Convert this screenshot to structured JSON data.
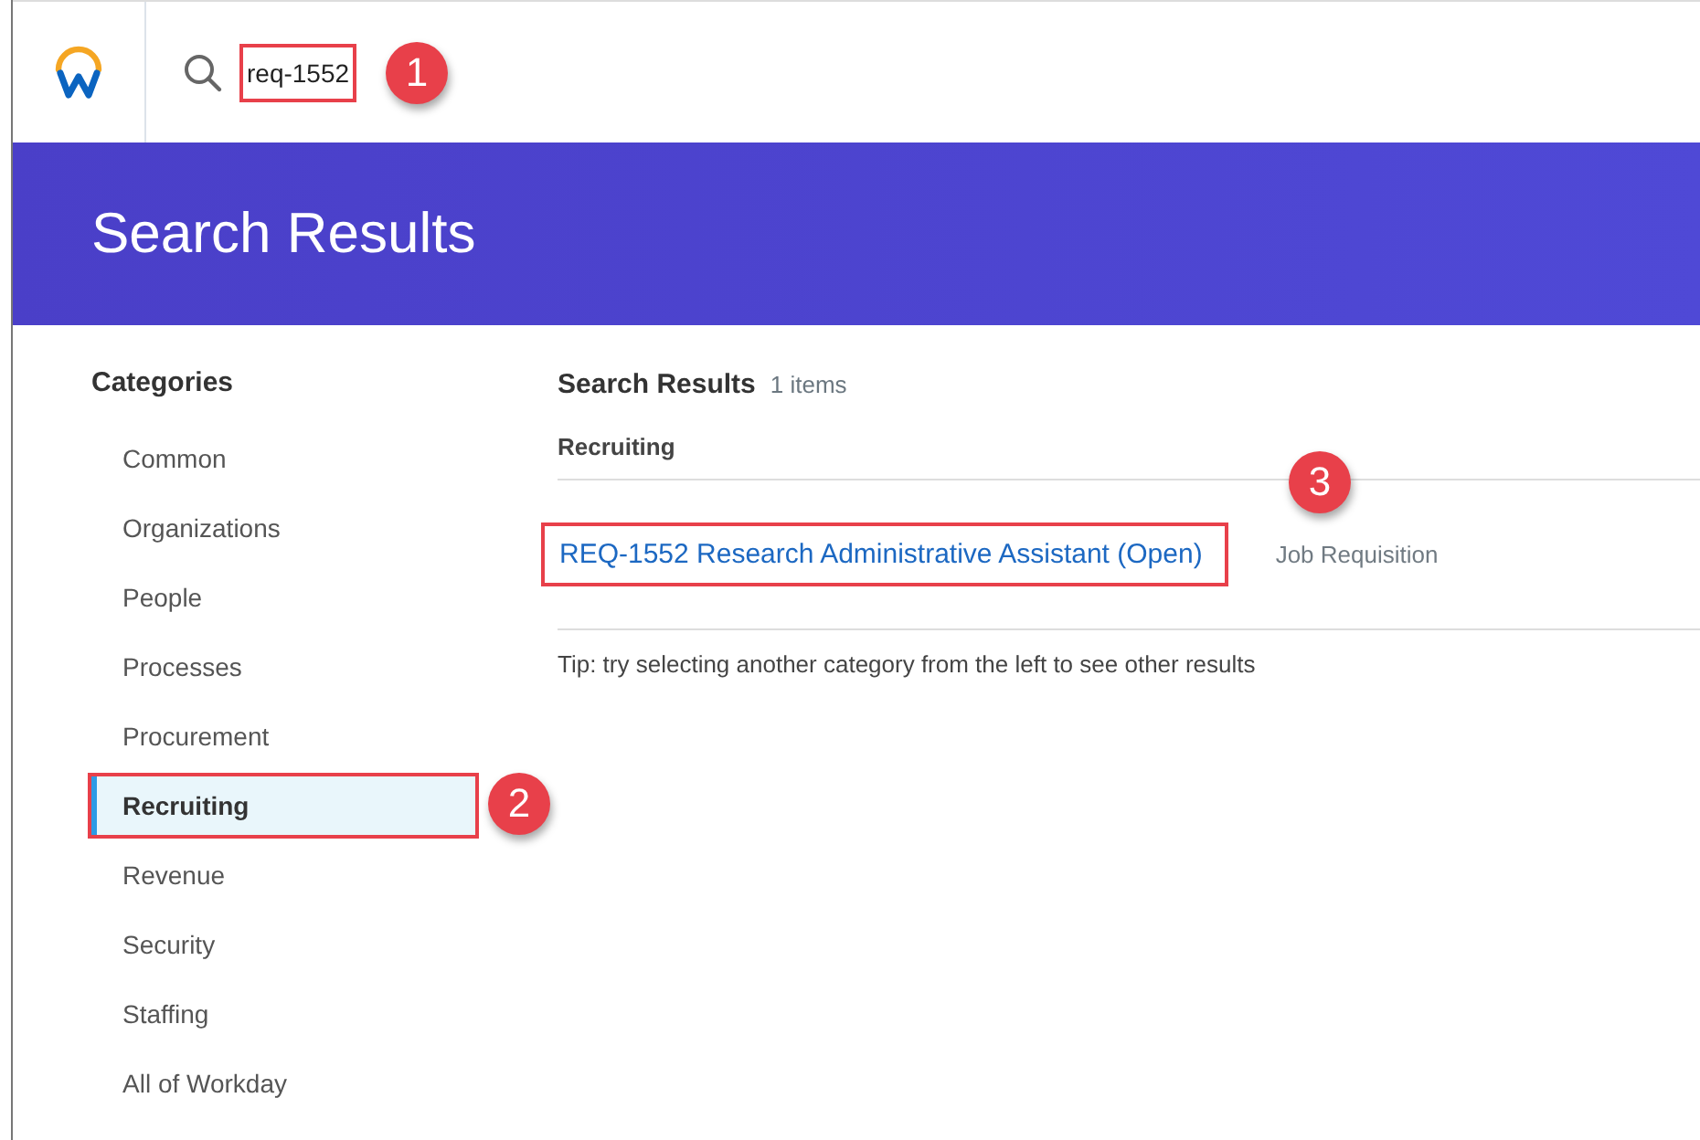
{
  "search": {
    "value": "req-1552",
    "callout": "1"
  },
  "banner": {
    "title": "Search Results"
  },
  "categories": {
    "heading": "Categories",
    "items": [
      {
        "label": "Common",
        "selected": false
      },
      {
        "label": "Organizations",
        "selected": false
      },
      {
        "label": "People",
        "selected": false
      },
      {
        "label": "Processes",
        "selected": false
      },
      {
        "label": "Procurement",
        "selected": false
      },
      {
        "label": "Recruiting",
        "selected": true,
        "callout": "2"
      },
      {
        "label": "Revenue",
        "selected": false
      },
      {
        "label": "Security",
        "selected": false
      },
      {
        "label": "Staffing",
        "selected": false
      },
      {
        "label": "All of Workday",
        "selected": false
      }
    ]
  },
  "results": {
    "heading": "Search Results",
    "count": "1 items",
    "group": "Recruiting",
    "items": [
      {
        "title": "REQ-1552 Research Administrative Assistant (Open)",
        "type": "Job Requisition",
        "callout": "3"
      }
    ],
    "tip": "Tip: try selecting another category from the left to see other results"
  }
}
